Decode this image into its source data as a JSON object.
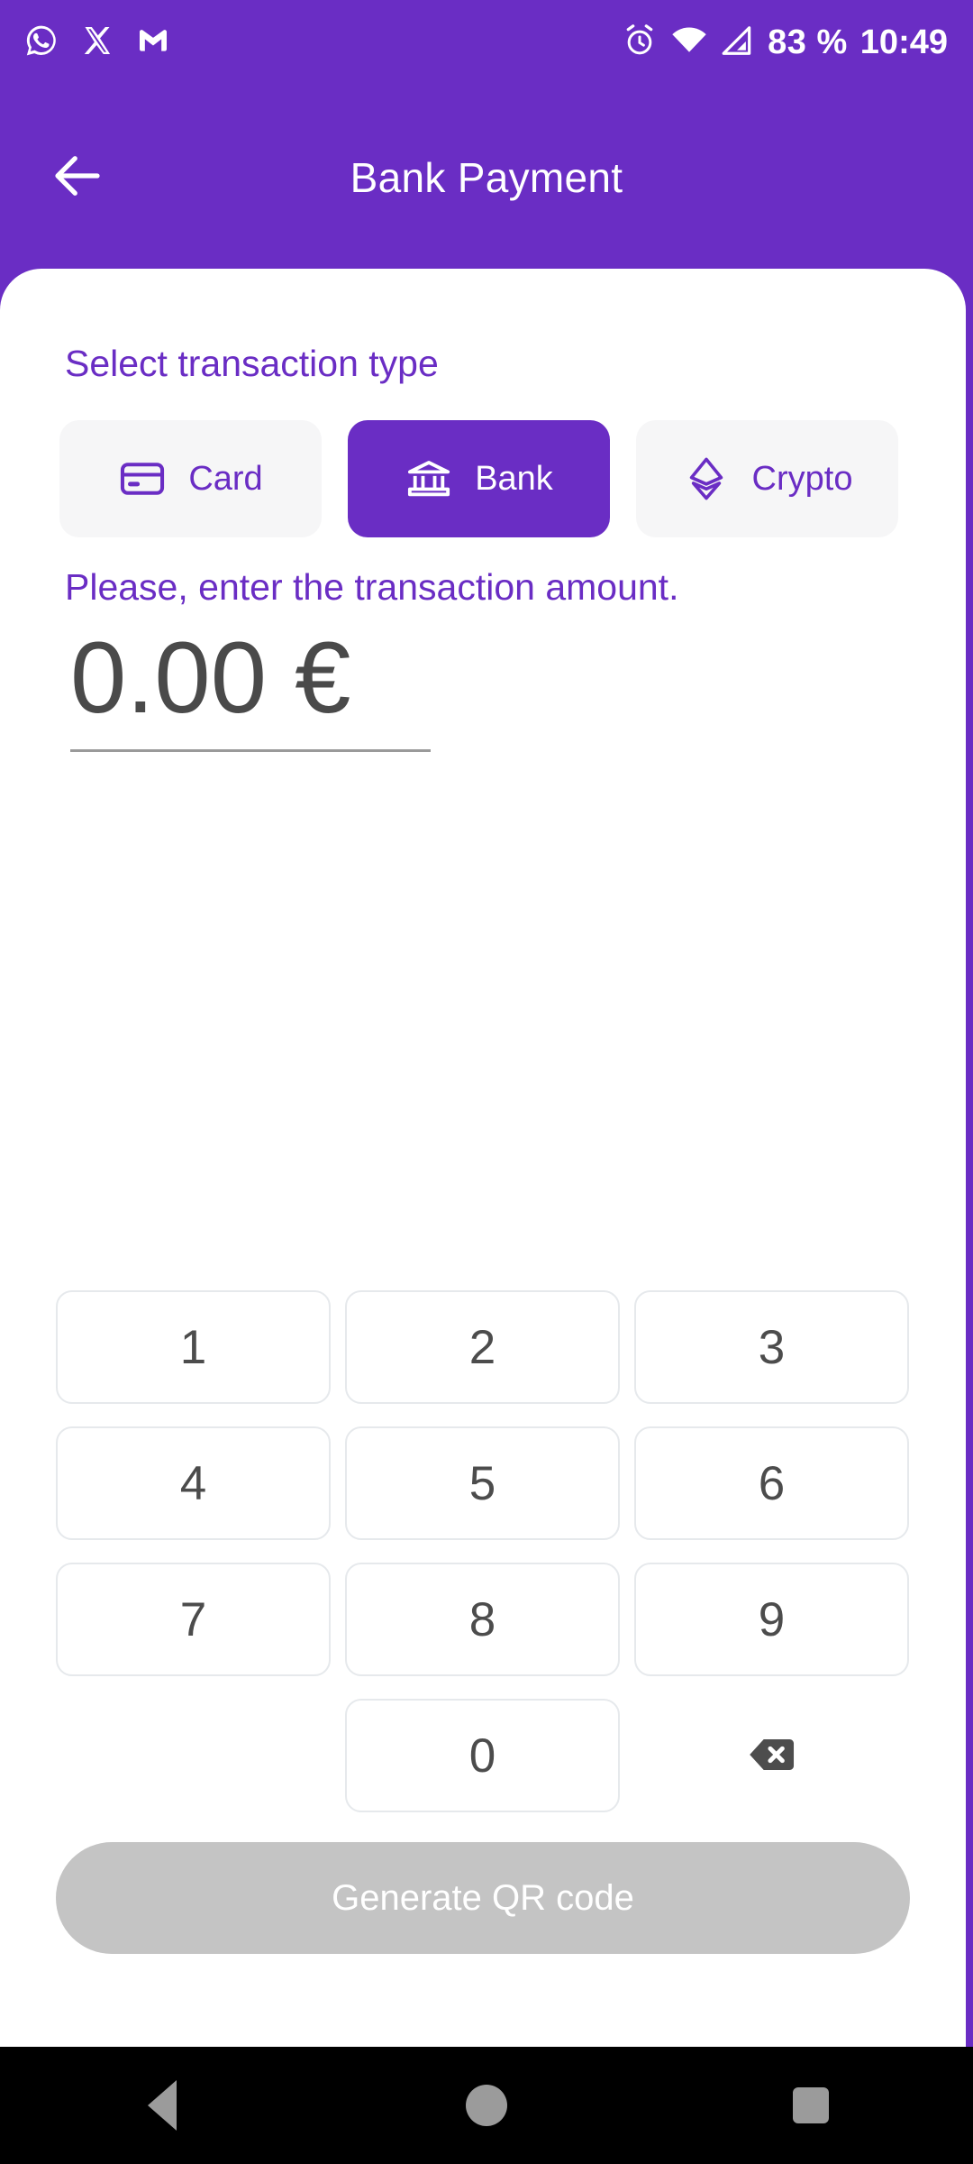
{
  "status_bar": {
    "notification_icons": [
      "whatsapp-icon",
      "x-twitter-icon",
      "gmail-icon"
    ],
    "alarm_icon": "alarm-clock-icon",
    "wifi_icon": "wifi-icon",
    "signal_icon": "cellular-signal-icon",
    "battery_percent": "83 %",
    "time": "10:49"
  },
  "app_bar": {
    "back_icon": "arrow-left-icon",
    "title": "Bank Payment"
  },
  "content": {
    "select_type_title": "Select transaction type",
    "transaction_types": [
      {
        "id": "card",
        "label": "Card",
        "icon": "credit-card-icon",
        "selected": false
      },
      {
        "id": "bank",
        "label": "Bank",
        "icon": "bank-icon",
        "selected": true
      },
      {
        "id": "crypto",
        "label": "Crypto",
        "icon": "ethereum-icon",
        "selected": false
      }
    ],
    "amount_prompt": "Please, enter the transaction amount.",
    "amount_value": "0.00 €",
    "keypad": [
      "1",
      "2",
      "3",
      "4",
      "5",
      "6",
      "7",
      "8",
      "9",
      "0"
    ],
    "backspace_icon": "backspace-icon",
    "generate_button": {
      "label": "Generate QR code",
      "enabled": false
    }
  },
  "nav_bar": {
    "back": "nav-back-icon",
    "home": "nav-home-icon",
    "recents": "nav-recents-icon"
  },
  "colors": {
    "brand_purple": "#6a2dc4",
    "chip_inactive_bg": "#f6f6f7",
    "amount_text": "#4a4a4a",
    "disabled_button": "#c4c4c4",
    "key_border": "#e6e9ec"
  }
}
